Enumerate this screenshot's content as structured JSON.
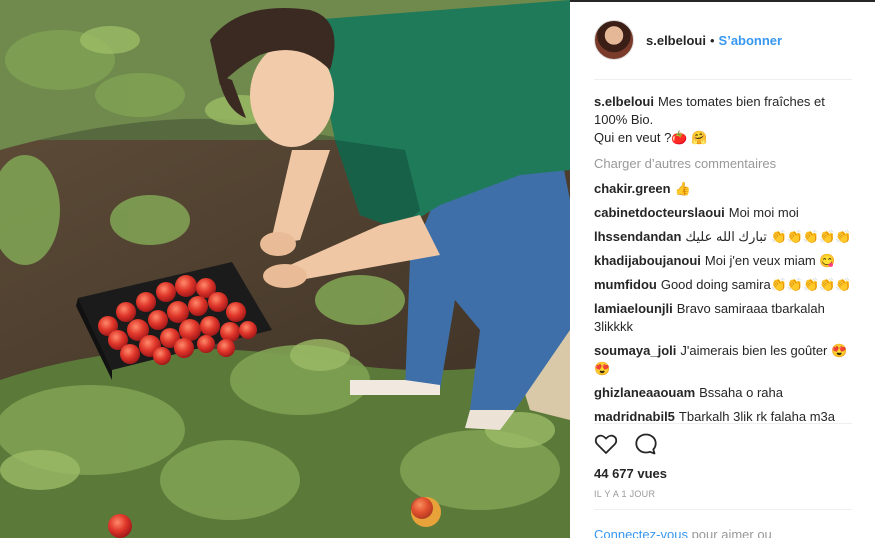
{
  "post": {
    "username": "s.elbeloui",
    "separator": "•",
    "follow_label": "S’abonner",
    "caption_user": "s.elbeloui",
    "caption_line1": "Mes tomates bien fraîches et",
    "caption_line2": "100% Bio.",
    "caption_line3": "Qui en veut ?🍅 🤗",
    "load_more": "Charger d’autres commentaires",
    "comments": [
      {
        "user": "chakir.green",
        "text": "👍"
      },
      {
        "user": "cabinetdocteurslaoui",
        "text": "Moi moi moi"
      },
      {
        "user": "lhssendandan",
        "text": "تبارك الله عليك 👏👏👏👏👏"
      },
      {
        "user": "khadijaboujanoui",
        "text": "Moi j'en veux miam 😋"
      },
      {
        "user": "mumfidou",
        "text": "Good doing samira👏👏👏👏👏"
      },
      {
        "user": "lamiaelounjli",
        "text": "Bravo samiraaa tbarkalah 3likkkk"
      },
      {
        "user": "soumaya_joli",
        "text": "J'aimerais bien les goûter 😍😍"
      },
      {
        "user": "ghizlaneaaouam",
        "text": "Bssaha o raha"
      },
      {
        "user": "madridnabil5",
        "text": "Tbarkalh 3lik rk falaha m3a"
      }
    ],
    "views": "44 677 vues",
    "time_ago": "IL Y A 1 JOUR",
    "login_link": "Connectez-vous",
    "login_rest": "pour aimer ou"
  },
  "icons": {
    "like": "heart-icon",
    "comment": "comment-bubble-icon"
  },
  "colors": {
    "accent": "#3897f0",
    "muted": "#999999",
    "text": "#262626",
    "shirt": "#1f7a5a",
    "jeans": "#3f6fa8",
    "tomato": "#e0362a"
  }
}
